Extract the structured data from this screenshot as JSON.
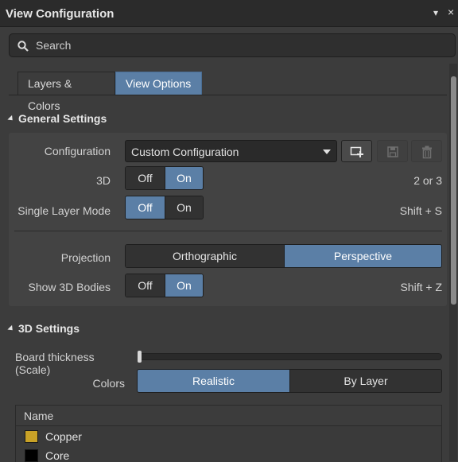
{
  "window": {
    "title": "View Configuration",
    "pin_glyph": "▾",
    "close_glyph": "×"
  },
  "search": {
    "placeholder": "Search",
    "icon": "search-icon"
  },
  "tabs": [
    {
      "label": "Layers & Colors",
      "active": false
    },
    {
      "label": "View Options",
      "active": true
    }
  ],
  "general": {
    "heading": "General Settings",
    "configuration": {
      "label": "Configuration",
      "value": "Custom Configuration",
      "icons": [
        "add-configuration-icon",
        "save-icon",
        "delete-icon"
      ]
    },
    "view3d": {
      "label": "3D",
      "off": "Off",
      "on": "On",
      "selected": "On",
      "shortcut": "2 or 3"
    },
    "single_layer": {
      "label": "Single Layer Mode",
      "off": "Off",
      "on": "On",
      "selected": "Off",
      "shortcut": "Shift + S"
    },
    "projection": {
      "label": "Projection",
      "options": [
        "Orthographic",
        "Perspective"
      ],
      "selected": "Perspective"
    },
    "show_bodies": {
      "label": "Show 3D Bodies",
      "off": "Off",
      "on": "On",
      "selected": "On",
      "shortcut": "Shift + Z"
    }
  },
  "settings3d": {
    "heading": "3D Settings",
    "board_thickness": {
      "label": "Board thickness (Scale)",
      "value": 0
    },
    "colors": {
      "label": "Colors",
      "options": [
        "Realistic",
        "By Layer"
      ],
      "selected": "Realistic"
    },
    "table": {
      "header": "Name",
      "rows": [
        {
          "name": "Copper",
          "color": "#c9a227"
        },
        {
          "name": "Core",
          "color": "#000000"
        }
      ]
    }
  },
  "colors": {
    "accent": "#5b7fa6",
    "background": "#3c3c3c",
    "panel": "#434343"
  }
}
